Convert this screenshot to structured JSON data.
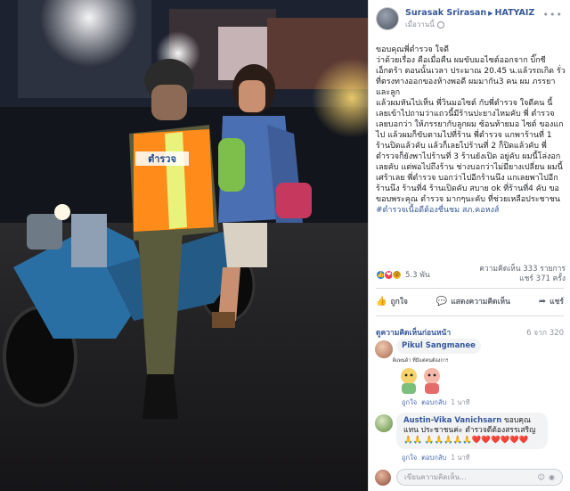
{
  "post": {
    "author": "Surasak Srirasan",
    "page": "HATYAIZ",
    "time": "เมื่อวานนี้",
    "paragraphs": [
      "ขอบคุณพี่ตำรวจ ใจดี",
      "ว่าด้วยเรื่อง คือเมื่อคืน ผมขับมอไซต์ออกจาก บิ๊กซี เอ็กตร้า ตอนนั้นเวลา ประมาณ 20.45 น.แล้วรถเกิด รั่ว ที่ตรงทางออกของห้างพอดี ผมมากัน3 คน ผม ภรรยา และลูก",
      "แล้วผมหันไปเห็น พี่วินมอไซต์ กับพี่ตำรวจ ใจดีคน นี้ เลยเข้าไปถามว่าแถวนี้มีร้านปะยางไหมคับ พี่ ตำรวจ เลยบอกว่า ให้ภรรยากับลูกผม ซ้อนท้ายมอ ไซต์ ของแกไป แล้วผมก็ขับตามไปที่ร้าน พี่ตำรวจ แกพาร้านที่ 1 ร้านปิดแล้วคับ แล้วก็เลยไปร้านที่ 2 ก็ปิดแล้วคับ พี่ตำรวจก็ยังพาไปร้านที่ 3 ร้านยังเปิด อยู่คับ ผมนี้โล่งอกเลยคับ แต่พอไปถึงร้าน ช่างบอกว่าไม่มียางเปลี่ยน ผมนี้เศร้าเลย พี่ตำรวจ บอกว่าไปอีกร้านนึง แกเลยพาไปอีกร้านนึง ร้านที่4 ร้านเปิดคับ สบาย ok ที่ร้านที่4 คับ ขอขอบพระคุณ ตำรวจ มากๆนะคับ ที่ช่วยเหลือประชาชน"
    ],
    "hashtag": "#ตำรวจเนื้อดีต้องชื่นชม สภ.คอหงส์"
  },
  "stats": {
    "reactions": "5.3 พัน",
    "comments": "ความคิดเห็น 333 รายการ",
    "shares": "แชร์ 371 ครั้ง"
  },
  "actions": {
    "like": "ถูกใจ",
    "comment": "แสดงความคิดเห็น",
    "share": "แชร์"
  },
  "comments_section": {
    "view_previous": "ดูความคิดเห็นก่อนหน้า",
    "count_of": "6 จาก 320",
    "items": [
      {
        "name": "Pikul Sangmanee",
        "text": "",
        "like": "ถูกใจ",
        "reply": "ตอบกลับ",
        "time": "1 นาที"
      },
      {
        "name": "Austin-Vika Vanichsarn",
        "text": "ขอบคุณแทน ประชาชนค่ะ ตำรวจดีต้องสรรเสริญ 🙏🙏 🙏🙏🙏🙏🙏❤️❤️❤️❤️❤️❤️",
        "like": "ถูกใจ",
        "reply": "ตอบกลับ",
        "time": "1 นาที"
      }
    ],
    "sticker_text": "พี่แพนด้า ที่มีแต่คนต้องการ"
  },
  "compose": {
    "placeholder": "เขียนความคิดเห็น..."
  },
  "photo": {
    "vest_text": "ตำรวจ"
  }
}
